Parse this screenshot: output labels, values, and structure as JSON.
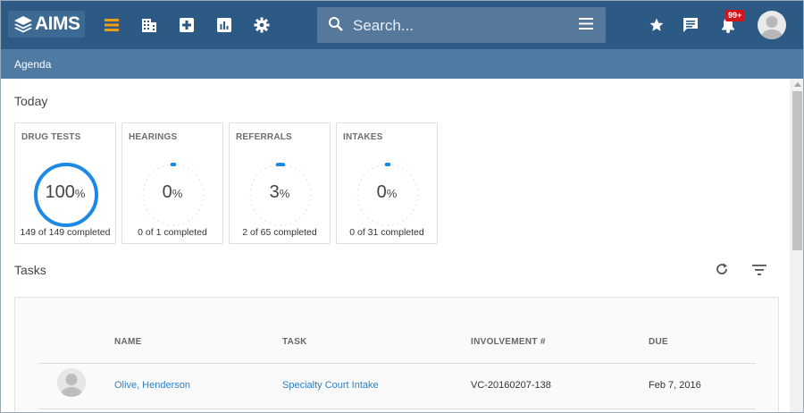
{
  "app": {
    "logo_text": "AIMS"
  },
  "search": {
    "placeholder": "Search..."
  },
  "notifications": {
    "badge": "99+"
  },
  "subbar": {
    "title": "Agenda"
  },
  "today": {
    "title": "Today",
    "cards": [
      {
        "title": "DRUG TESTS",
        "value": "100",
        "unit": "%",
        "footer": "149 of 149 completed",
        "progress": 1.0
      },
      {
        "title": "HEARINGS",
        "value": "0",
        "unit": "%",
        "footer": "0 of 1 completed",
        "progress": 0.0
      },
      {
        "title": "REFERRALS",
        "value": "3",
        "unit": "%",
        "footer": "2 of 65 completed",
        "progress": 0.03
      },
      {
        "title": "INTAKES",
        "value": "0",
        "unit": "%",
        "footer": "0 of 31 completed",
        "progress": 0.0
      }
    ]
  },
  "tasks": {
    "title": "Tasks",
    "columns": [
      "NAME",
      "TASK",
      "INVOLVEMENT #",
      "DUE"
    ],
    "rows": [
      {
        "name": "Olive, Henderson",
        "task": "Specialty Court Intake",
        "involvement": "VC-20160207-138",
        "due": "Feb 7, 2016"
      }
    ]
  },
  "colors": {
    "topbar": "#2c5a85",
    "subbar": "#4f7aa2",
    "accent": "#1e88e5",
    "link": "#2f7fbf",
    "badge": "#d0161b"
  }
}
